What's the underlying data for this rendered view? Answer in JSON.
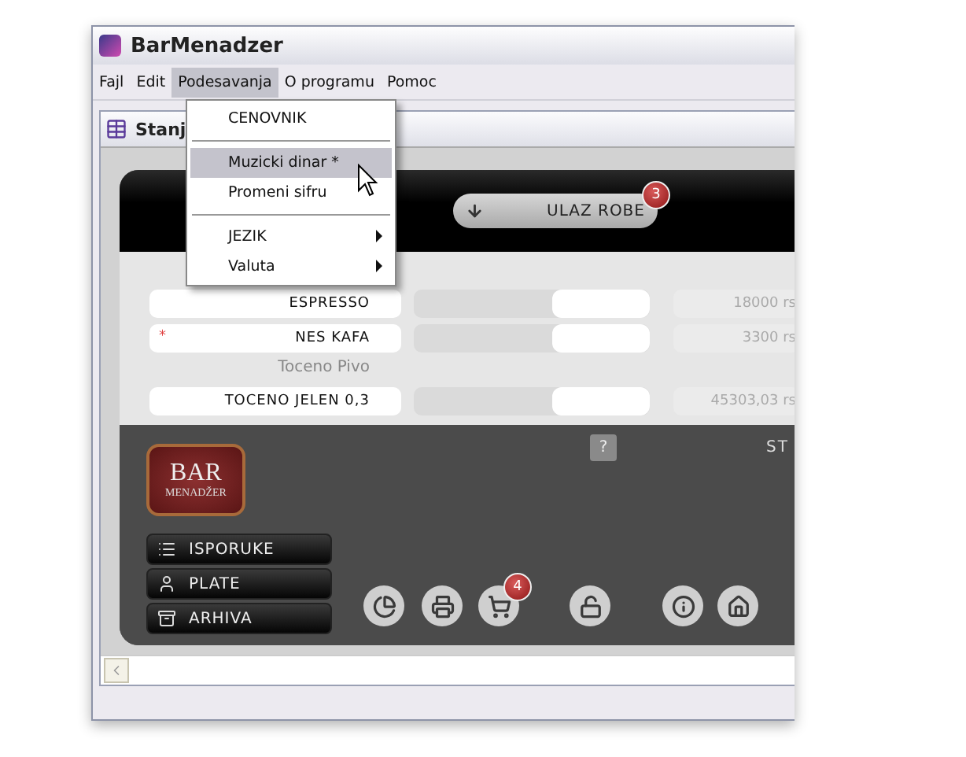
{
  "window": {
    "title": "BarMenadzer"
  },
  "menu_bar": [
    {
      "label": "Fajl",
      "selected": false
    },
    {
      "label": "Edit",
      "selected": false
    },
    {
      "label": "Podesavanja",
      "selected": true
    },
    {
      "label": "O programu",
      "selected": false
    },
    {
      "label": "Pomoc",
      "selected": false
    }
  ],
  "dropdown": [
    {
      "kind": "item",
      "label": "CENOVNIK",
      "selected": false
    },
    {
      "kind": "separator"
    },
    {
      "kind": "item",
      "label": "Muzicki dinar *",
      "selected": true
    },
    {
      "kind": "item",
      "label": "Promeni sifru",
      "selected": false
    },
    {
      "kind": "separator"
    },
    {
      "kind": "submenu",
      "label": "JEZIK",
      "selected": false
    },
    {
      "kind": "submenu",
      "label": "Valuta",
      "selected": false
    }
  ],
  "inner_window": {
    "title": "Stanj"
  },
  "header": {
    "button": "ULAZ ROBE",
    "badge": "3"
  },
  "rows": [
    {
      "kind": "item",
      "name": "ESPRESSO",
      "price": "18000 rs"
    },
    {
      "kind": "item",
      "name": "NES KAFA",
      "marker": "*",
      "price": "3300 rs"
    },
    {
      "kind": "category",
      "name": "Toceno Pivo"
    },
    {
      "kind": "item",
      "name": "TOCENO JELEN 0,3",
      "price": "45303,03 rs"
    }
  ],
  "logo": {
    "line_1": "BAR",
    "line_2": "MENADŽER"
  },
  "help_button": "?",
  "corner_text": "ST",
  "side_buttons": [
    {
      "kind": "list",
      "label": "ISPORUKE"
    },
    {
      "kind": "person",
      "label": "PLATE"
    },
    {
      "kind": "archive",
      "label": "ARHIVA"
    }
  ],
  "tools": [
    {
      "kind": "chart"
    },
    {
      "kind": "print"
    },
    {
      "kind": "cart",
      "badge": "4"
    },
    {
      "kind": "lock"
    },
    {
      "kind": "info"
    },
    {
      "kind": "home"
    }
  ]
}
